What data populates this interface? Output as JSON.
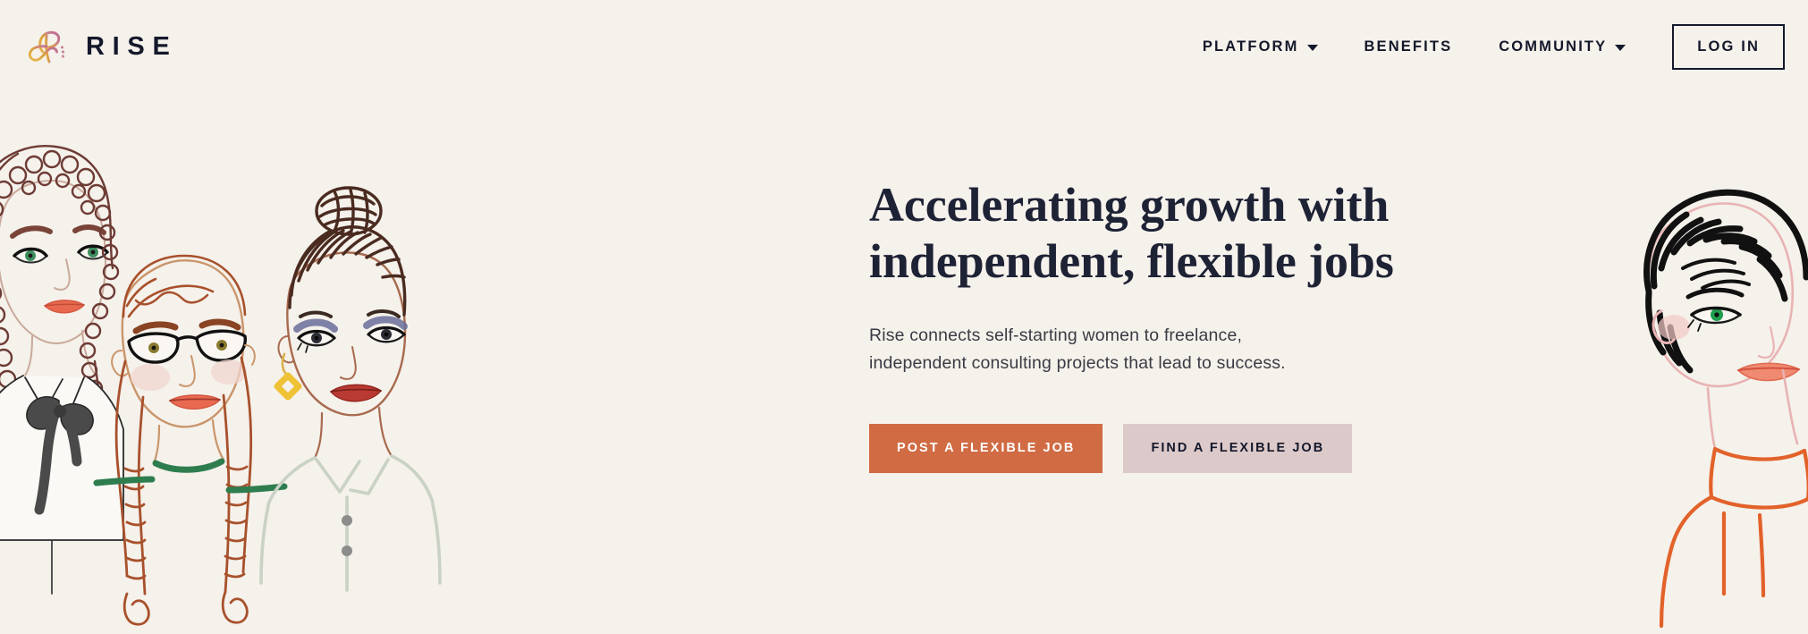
{
  "site": {
    "background_color": "#F5F1EB",
    "brand_name": "RISE",
    "logo_icon": "rise-script-r-logo",
    "logo_colors": [
      "#E8B84B",
      "#D9A03C",
      "#C97B94",
      "#B9688A"
    ]
  },
  "header": {
    "nav_items": [
      {
        "label": "PLATFORM",
        "has_dropdown": true,
        "icon": "chevron-down-icon"
      },
      {
        "label": "BENEFITS",
        "has_dropdown": false,
        "icon": ""
      },
      {
        "label": "COMMUNITY",
        "has_dropdown": true,
        "icon": "chevron-down-icon"
      }
    ],
    "login_label": "LOG IN",
    "text_color": "#14182B"
  },
  "hero": {
    "headline": "Accelerating growth with\nindependent, flexible jobs",
    "headline_color": "#1E2235",
    "subcopy": "Rise connects self-starting women to freelance,\nindependent consulting projects that lead to success.",
    "subcopy_color": "#3B3B44",
    "buttons": [
      {
        "label": "POST A FLEXIBLE JOB",
        "style": "primary",
        "bg": "#D06B43",
        "fg": "#FFFFFF"
      },
      {
        "label": "FIND A FLEXIBLE JOB",
        "style": "secondary",
        "bg": "#DCC9C9",
        "fg": "#14182B"
      }
    ]
  },
  "illustration_left": {
    "description": "Hand-drawn line illustration of three women",
    "figures": [
      {
        "name": "woman-curly-hair",
        "hair": "long curly auburn",
        "hair_color": "#6E3B35",
        "eyes": "green",
        "eye_color": "#2E7D4F",
        "lips_color": "#E8694F",
        "clothing": "white blouse with dark grey bow tie",
        "clothing_accent": "#4A4A4A"
      },
      {
        "name": "woman-braids-glasses",
        "hair": "long auburn braids with bangs",
        "hair_color": "#A8512C",
        "eyes": "hazel",
        "eye_color": "#8A7A30",
        "glasses": true,
        "glasses_color": "#111111",
        "lips_color": "#E8694F",
        "clothing": "green top",
        "clothing_accent": "#2E7D4F"
      },
      {
        "name": "woman-top-bun",
        "hair": "dark brown hair in top bun",
        "hair_color": "#4A2B20",
        "eyes": "blue eyeshadow",
        "eye_color": "#6A6E9A",
        "lips_color": "#B83A32",
        "earrings": "yellow diamond hoops",
        "earring_color": "#EFC235",
        "clothing": "pale sage collared shirt with grey buttons",
        "clothing_accent": "#C9D2C4"
      }
    ]
  },
  "illustration_right": {
    "description": "Hand-drawn line illustration of a woman",
    "figure": {
      "name": "woman-short-black-hair",
      "hair": "short black pixie cut",
      "hair_color": "#111111",
      "eyes": "green",
      "eye_color": "#1F9D4E",
      "lips_color": "#E8694F",
      "clothing": "orange turtleneck",
      "clothing_accent": "#E2622A"
    }
  }
}
